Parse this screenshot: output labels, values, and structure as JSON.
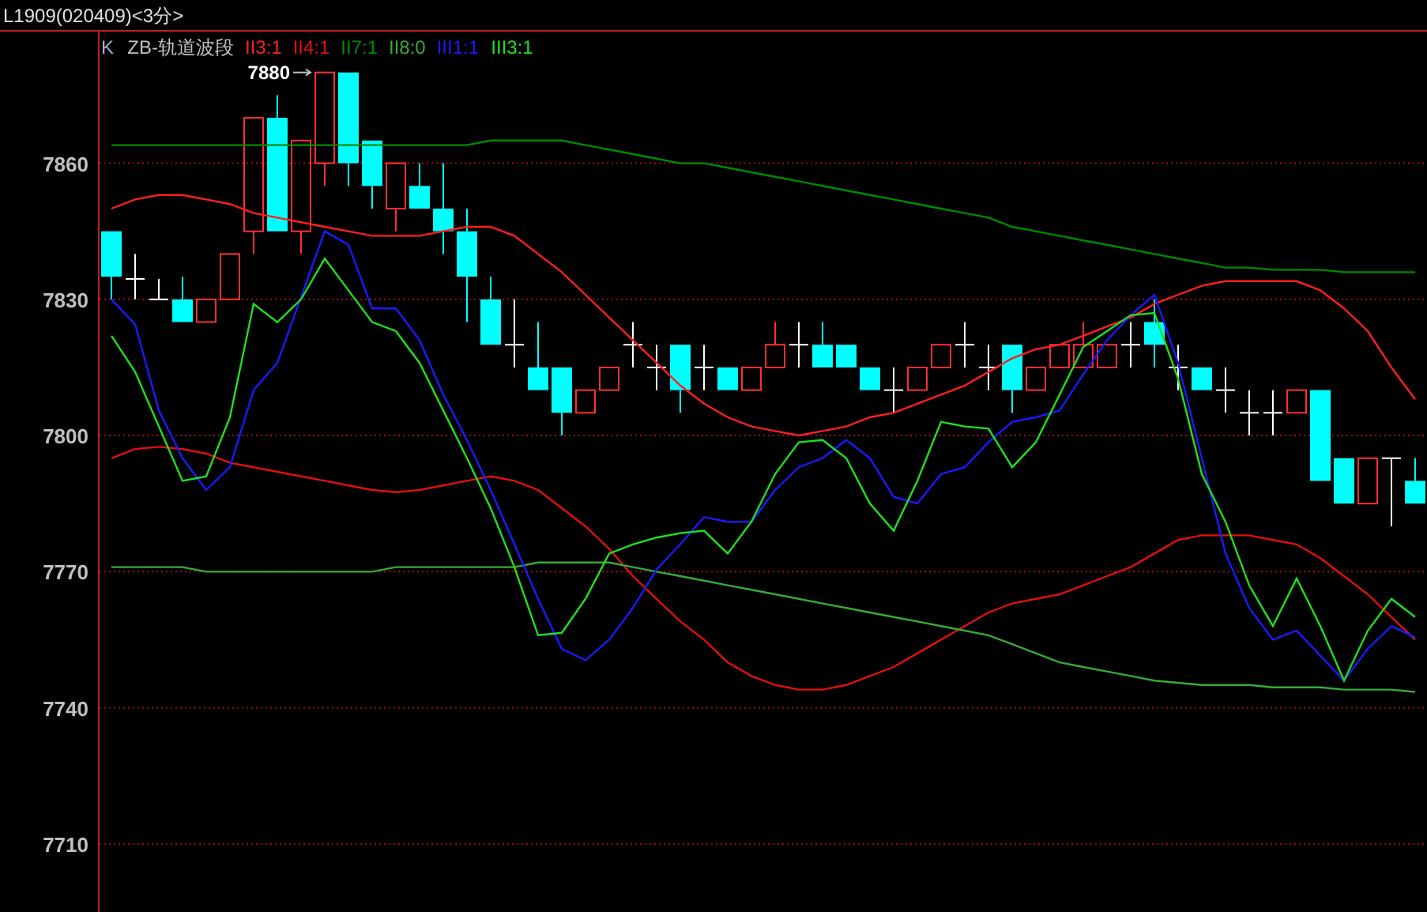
{
  "window": {
    "title": "L1909(020409)<3分>"
  },
  "chart": {
    "indicator_label": "K",
    "indicator_name": "ZB-轨道波段",
    "chart_data": {
      "type": "line",
      "yticks": [
        7710,
        7740,
        7770,
        7800,
        7830,
        7860
      ],
      "ylim": [
        7695,
        7889
      ],
      "grid": true,
      "annotations": [
        {
          "text": "7880"
        }
      ],
      "series": [
        {
          "name": "II3:1",
          "color": "#ff2020",
          "values": [
            7850,
            7852,
            7853,
            7853,
            7852,
            7851,
            7849,
            7848,
            7847,
            7846,
            7845,
            7844,
            7844,
            7844,
            7845,
            7846,
            7846,
            7844,
            7840,
            7836,
            7831,
            7826,
            7821,
            7816,
            7811,
            7807,
            7804,
            7802,
            7801,
            7800,
            7801,
            7802,
            7804,
            7805,
            7807,
            7809,
            7811,
            7814,
            7817,
            7819,
            7820,
            7822,
            7824,
            7826,
            7829,
            7831,
            7833,
            7834,
            7834,
            7834,
            7834,
            7832,
            7828,
            7823,
            7815,
            7808
          ]
        },
        {
          "name": "II4:1",
          "color": "#e01010",
          "values": [
            7795,
            7797,
            7797.5,
            7797,
            7796,
            7794,
            7793,
            7792,
            7791,
            7790,
            7789,
            7788,
            7787.5,
            7788,
            7789,
            7790,
            7791,
            7790,
            7788,
            7784,
            7780,
            7775,
            7769,
            7764,
            7759,
            7755,
            7750,
            7747,
            7745,
            7744,
            7744,
            7745,
            7747,
            7749,
            7752,
            7755,
            7758,
            7761,
            7763,
            7764,
            7765,
            7767,
            7769,
            7771,
            7774,
            7777,
            7778,
            7778,
            7778,
            7777,
            7776,
            7773,
            7769,
            7765,
            7760,
            7755
          ]
        },
        {
          "name": "II7:1",
          "color": "#008a00",
          "values": [
            7864,
            7864,
            7864,
            7864,
            7864,
            7864,
            7864,
            7864,
            7864,
            7864,
            7864,
            7864,
            7864,
            7864,
            7864,
            7864,
            7865,
            7865,
            7865,
            7865,
            7864,
            7863,
            7862,
            7861,
            7860,
            7860,
            7859,
            7858,
            7857,
            7856,
            7855,
            7854,
            7853,
            7852,
            7851,
            7850,
            7849,
            7848,
            7846,
            7845,
            7844,
            7843,
            7842,
            7841,
            7840,
            7839,
            7838,
            7837,
            7837,
            7836.5,
            7836.5,
            7836.5,
            7836,
            7836,
            7836,
            7836
          ]
        },
        {
          "name": "II8:0",
          "color": "#3aa83a",
          "values": [
            7771,
            7771,
            7771,
            7771,
            7770,
            7770,
            7770,
            7770,
            7770,
            7770,
            7770,
            7770,
            7771,
            7771,
            7771,
            7771,
            7771,
            7771,
            7772,
            7772,
            7772,
            7772,
            7771,
            7770,
            7769,
            7768,
            7767,
            7766,
            7765,
            7764,
            7763,
            7762,
            7761,
            7760,
            7759,
            7758,
            7757,
            7756,
            7754,
            7752,
            7750,
            7749,
            7748,
            7747,
            7746,
            7745.5,
            7745,
            7745,
            7745,
            7744.5,
            7744.5,
            7744.5,
            7744,
            7744,
            7744,
            7743.5
          ]
        },
        {
          "name": "III1:1",
          "color": "#1a1aff",
          "values": [
            7830,
            7824.5,
            7805.5,
            7795,
            7788,
            7793,
            7810,
            7816,
            7830.5,
            7845,
            7842,
            7828,
            7828,
            7821,
            7809,
            7799,
            7788,
            7776,
            7764,
            7753,
            7750.5,
            7755,
            7762,
            7770.5,
            7776,
            7782,
            7781,
            7781,
            7788,
            7793,
            7795,
            7799,
            7795,
            7786.5,
            7785,
            7791.5,
            7793,
            7798.5,
            7803,
            7804,
            7805.5,
            7813.5,
            7821,
            7826.5,
            7831,
            7816,
            7795,
            7774,
            7762,
            7755,
            7757,
            7751.5,
            7746,
            7753,
            7758,
            7755.5
          ]
        },
        {
          "name": "III3:1",
          "color": "#20e020",
          "values": [
            7822,
            7814,
            7802,
            7790,
            7791,
            7804,
            7829,
            7825,
            7830,
            7839,
            7832,
            7825,
            7823,
            7816,
            7805.5,
            7795,
            7784,
            7771,
            7756,
            7756.5,
            7764,
            7774,
            7776,
            7777.5,
            7778.5,
            7779,
            7774,
            7781,
            7791.5,
            7798.5,
            7799,
            7795,
            7785,
            7779,
            7790,
            7803,
            7802,
            7801.5,
            7793,
            7798.5,
            7809,
            7819.5,
            7823,
            7826.5,
            7827,
            7812.5,
            7791.5,
            7781,
            7767,
            7758,
            7768.5,
            7758,
            7746,
            7757,
            7764,
            7760
          ]
        }
      ]
    }
  }
}
